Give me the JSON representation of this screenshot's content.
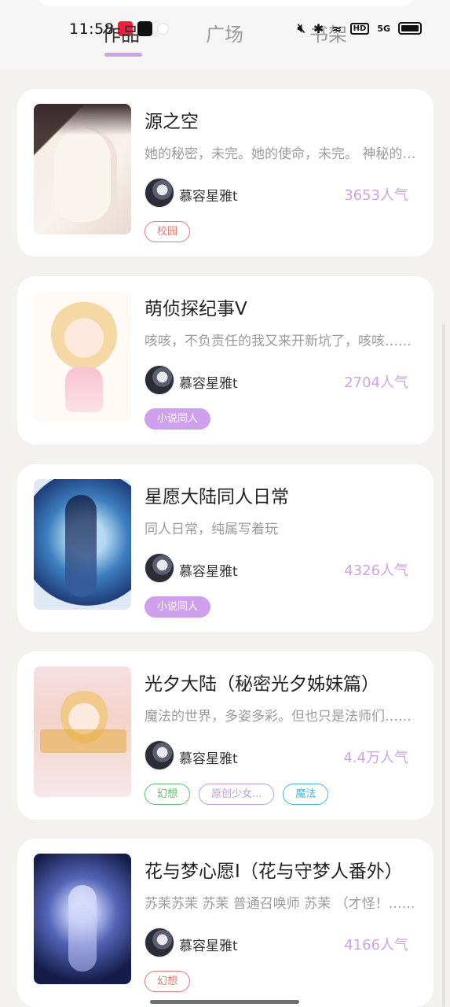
{
  "status_bar": {
    "time": "11:58",
    "network": "5G",
    "hd": "HD"
  },
  "tabs": [
    {
      "label": "作品",
      "active": true
    },
    {
      "label": "广场",
      "active": false
    },
    {
      "label": "书架",
      "active": false
    }
  ],
  "colors": {
    "accent": "#c8a6e6",
    "popularity": "#cfa3e4",
    "background": "#f3f2ee"
  },
  "works": [
    {
      "title": "源之空",
      "description": "她的秘密，未完。她的使命，未完。 神秘的少女……",
      "author": "慕容星雅t",
      "popularity": "3653人气",
      "tags": [
        {
          "label": "校园",
          "style": "red"
        }
      ]
    },
    {
      "title": "萌侦探纪事V",
      "description": "咳咳，不负责任的我又来开新坑了，咳咳……",
      "author": "慕容星雅t",
      "popularity": "2704人气",
      "tags": [
        {
          "label": "小说同人",
          "style": "purple-filled"
        }
      ]
    },
    {
      "title": "星愿大陆同人日常",
      "description": "同人日常，纯属写着玩",
      "author": "慕容星雅t",
      "popularity": "4326人气",
      "tags": [
        {
          "label": "小说同人",
          "style": "purple-filled"
        }
      ]
    },
    {
      "title": "光夕大陆（秘密光夕姊妹篇）",
      "description": "魔法的世界，多姿多彩。但也只是法师们……",
      "author": "慕容星雅t",
      "popularity": "4.4万人气",
      "tags": [
        {
          "label": "幻想",
          "style": "green"
        },
        {
          "label": "原创少女...",
          "style": "lilac"
        },
        {
          "label": "魔法",
          "style": "cyan"
        }
      ]
    },
    {
      "title": "花与梦心愿I（花与守梦人番外）",
      "description": "苏茉苏茉 苏茉 普通召唤师 苏茉 （才怪！……",
      "author": "慕容星雅t",
      "popularity": "4166人气",
      "tags": [
        {
          "label": "幻想",
          "style": "red"
        }
      ]
    }
  ]
}
